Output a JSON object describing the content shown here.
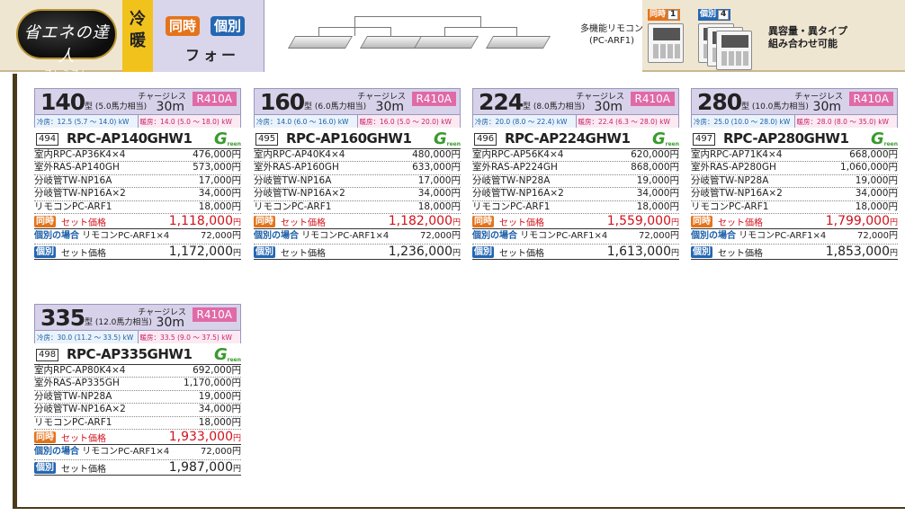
{
  "header": {
    "logo_text": "省エネの達人",
    "logo_sub": "プレミアム",
    "mode": "冷暖",
    "tag_doji": "同時",
    "tag_kobetsu": "個別",
    "type_label": "フォー",
    "remote_label_line1": "多機能リモコン",
    "remote_label_line2": "(PC-ARF1)",
    "doji_count_label": "同時",
    "doji_count": "1",
    "kobetsu_count_label": "個別",
    "kobetsu_count": "4",
    "combo_line1": "異容量・異タイプ",
    "combo_line2": "組み合わせ可能"
  },
  "common": {
    "chargeless": "チャージレス",
    "refrigerant": "R410A",
    "green_mark": "G",
    "green_sub": "reen",
    "set_price_label": "セット価格",
    "indiv_label": "個別の場合",
    "indiv_remote": "リモコンPC-ARF1×4",
    "indiv_remote_price": "72,000円",
    "yen": "円"
  },
  "cards": [
    {
      "size": "140",
      "size_suffix": "型 (5.0馬力相当)",
      "pipe": "30m",
      "cool": "冷房：12.5 (5.7 ～ 14.0) kW",
      "heat": "暖房：14.0 (5.0 ～ 18.0) kW",
      "no": "494",
      "model": "RPC-AP140GHW1",
      "lines": [
        {
          "k": "室内RPC-AP36K4×4",
          "v": "476,000円"
        },
        {
          "k": "室外RAS-AP140GH",
          "v": "573,000円"
        },
        {
          "k": "分岐管TW-NP16A",
          "v": "17,000円"
        },
        {
          "k": "分岐管TW-NP16A×2",
          "v": "34,000円"
        },
        {
          "k": "リモコンPC-ARF1",
          "v": "18,000円"
        }
      ],
      "doji_price": "1,118,000",
      "kobetsu_price": "1,172,000"
    },
    {
      "size": "160",
      "size_suffix": "型 (6.0馬力相当)",
      "pipe": "30m",
      "cool": "冷房：14.0 (6.0 ～ 16.0) kW",
      "heat": "暖房：16.0 (5.0 ～ 20.0) kW",
      "no": "495",
      "model": "RPC-AP160GHW1",
      "lines": [
        {
          "k": "室内RPC-AP40K4×4",
          "v": "480,000円"
        },
        {
          "k": "室外RAS-AP160GH",
          "v": "633,000円"
        },
        {
          "k": "分岐管TW-NP16A",
          "v": "17,000円"
        },
        {
          "k": "分岐管TW-NP16A×2",
          "v": "34,000円"
        },
        {
          "k": "リモコンPC-ARF1",
          "v": "18,000円"
        }
      ],
      "doji_price": "1,182,000",
      "kobetsu_price": "1,236,000"
    },
    {
      "size": "224",
      "size_suffix": "型 (8.0馬力相当)",
      "pipe": "30m",
      "cool": "冷房：20.0 (8.0 ～ 22.4) kW",
      "heat": "暖房：22.4 (6.3 ～ 28.0) kW",
      "no": "496",
      "model": "RPC-AP224GHW1",
      "lines": [
        {
          "k": "室内RPC-AP56K4×4",
          "v": "620,000円"
        },
        {
          "k": "室外RAS-AP224GH",
          "v": "868,000円"
        },
        {
          "k": "分岐管TW-NP28A",
          "v": "19,000円"
        },
        {
          "k": "分岐管TW-NP16A×2",
          "v": "34,000円"
        },
        {
          "k": "リモコンPC-ARF1",
          "v": "18,000円"
        }
      ],
      "doji_price": "1,559,000",
      "kobetsu_price": "1,613,000"
    },
    {
      "size": "280",
      "size_suffix": "型 (10.0馬力相当)",
      "pipe": "30m",
      "cool": "冷房：25.0 (10.0 ～ 28.0) kW",
      "heat": "暖房：28.0 (8.0 ～ 35.0) kW",
      "no": "497",
      "model": "RPC-AP280GHW1",
      "lines": [
        {
          "k": "室内RPC-AP71K4×4",
          "v": "668,000円"
        },
        {
          "k": "室外RAS-AP280GH",
          "v": "1,060,000円"
        },
        {
          "k": "分岐管TW-NP28A",
          "v": "19,000円"
        },
        {
          "k": "分岐管TW-NP16A×2",
          "v": "34,000円"
        },
        {
          "k": "リモコンPC-ARF1",
          "v": "18,000円"
        }
      ],
      "doji_price": "1,799,000",
      "kobetsu_price": "1,853,000"
    },
    {
      "size": "335",
      "size_suffix": "型 (12.0馬力相当)",
      "pipe": "30m",
      "cool": "冷房：30.0 (11.2 ～ 33.5) kW",
      "heat": "暖房：33.5 (9.0 ～ 37.5) kW",
      "no": "498",
      "model": "RPC-AP335GHW1",
      "lines": [
        {
          "k": "室内RPC-AP80K4×4",
          "v": "692,000円"
        },
        {
          "k": "室外RAS-AP335GH",
          "v": "1,170,000円"
        },
        {
          "k": "分岐管TW-NP28A",
          "v": "19,000円"
        },
        {
          "k": "分岐管TW-NP16A×2",
          "v": "34,000円"
        },
        {
          "k": "リモコンPC-ARF1",
          "v": "18,000円"
        }
      ],
      "doji_price": "1,933,000",
      "kobetsu_price": "1,987,000"
    }
  ]
}
